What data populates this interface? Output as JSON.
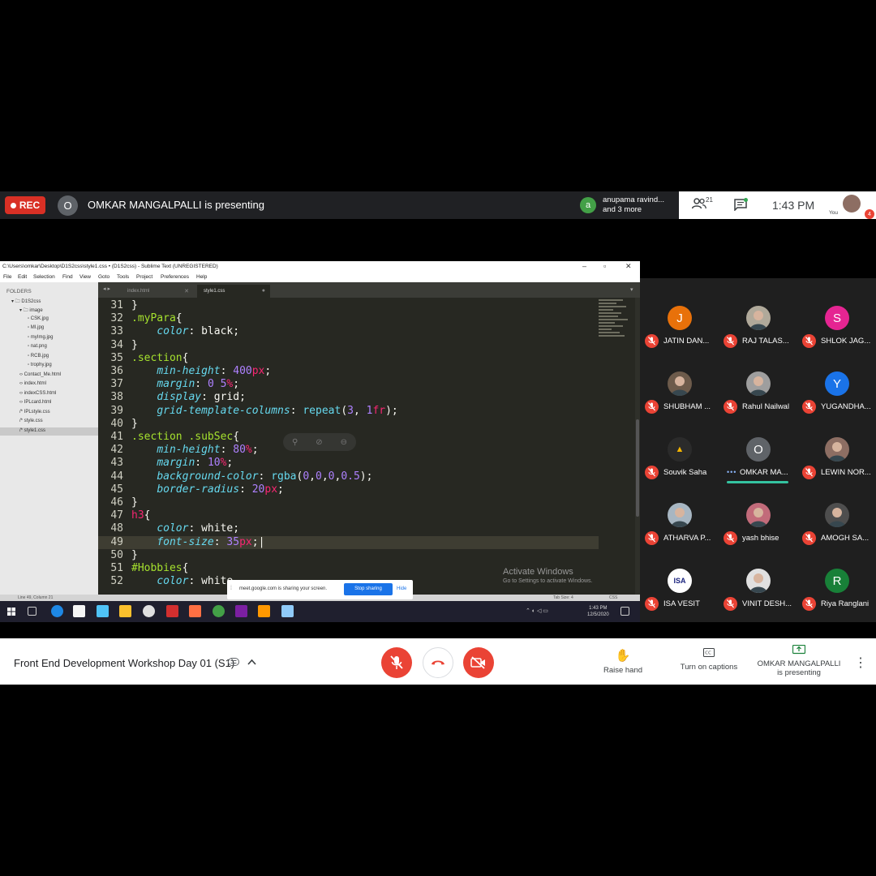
{
  "topbar": {
    "rec_label": "REC",
    "presenter_initial": "O",
    "presenter_text": "OMKAR MANGALPALLI is presenting",
    "notification_initial": "a",
    "notification_line1": "anupama ravind...",
    "notification_line2": "and 3 more",
    "participant_count": "21",
    "time": "1:43 PM",
    "you_label": "You",
    "badge_count": "4"
  },
  "screen": {
    "window_title": "C:\\Users\\omkar\\Desktop\\D1S2css\\style1.css • (D1S2css) - Sublime Text (UNREGISTERED)",
    "menu": [
      "File",
      "Edit",
      "Selection",
      "Find",
      "View",
      "Goto",
      "Tools",
      "Project",
      "Preferences",
      "Help"
    ],
    "sidebar": {
      "header": "FOLDERS",
      "root": "D1S2css",
      "image_folder": "image",
      "images": [
        "CSK.jpg",
        "MI.jpg",
        "myImg.jpg",
        "nat.png",
        "RCB.jpg",
        "trophy.jpg"
      ],
      "files": [
        "Contact_Me.html",
        "index.html",
        "indexCSS.html",
        "IPLcard.html",
        "IPLstyle.css",
        "style.css",
        "style1.css"
      ]
    },
    "tabs": [
      "index.html",
      "style1.css"
    ],
    "status_left": "Line 49, Column 21",
    "status_tab": "Tab Size: 4",
    "status_syntax": "CSS",
    "activate_title": "Activate Windows",
    "activate_sub": "Go to Settings to activate Windows.",
    "share_text": "meet.google.com is sharing your screen.",
    "stop_sharing": "Stop sharing",
    "hide": "Hide",
    "tray_time": "1:43 PM",
    "tray_date": "12/5/2020"
  },
  "code_lines": [
    {
      "n": "31",
      "parts": [
        [
          "p",
          "}"
        ]
      ]
    },
    {
      "n": "32",
      "parts": [
        [
          "s",
          ".myPara"
        ],
        [
          "p",
          "{"
        ]
      ]
    },
    {
      "n": "33",
      "parts": [
        [
          "p",
          "    "
        ],
        [
          "k",
          "color"
        ],
        [
          "p",
          ": black;"
        ]
      ]
    },
    {
      "n": "34",
      "parts": [
        [
          "p",
          "}"
        ]
      ]
    },
    {
      "n": "35",
      "parts": [
        [
          "s",
          ".section"
        ],
        [
          "p",
          "{"
        ]
      ]
    },
    {
      "n": "36",
      "parts": [
        [
          "p",
          "    "
        ],
        [
          "k",
          "min-height"
        ],
        [
          "p",
          ": "
        ],
        [
          "n",
          "400"
        ],
        [
          "u",
          "px"
        ],
        [
          "p",
          ";"
        ]
      ]
    },
    {
      "n": "37",
      "parts": [
        [
          "p",
          "    "
        ],
        [
          "k",
          "margin"
        ],
        [
          "p",
          ": "
        ],
        [
          "n",
          "0"
        ],
        [
          "p",
          " "
        ],
        [
          "n",
          "5"
        ],
        [
          "u",
          "%"
        ],
        [
          "p",
          ";"
        ]
      ]
    },
    {
      "n": "38",
      "parts": [
        [
          "p",
          "    "
        ],
        [
          "k",
          "display"
        ],
        [
          "p",
          ": grid;"
        ]
      ]
    },
    {
      "n": "39",
      "parts": [
        [
          "p",
          "    "
        ],
        [
          "k",
          "grid-template-columns"
        ],
        [
          "p",
          ": "
        ],
        [
          "f",
          "repeat"
        ],
        [
          "p",
          "("
        ],
        [
          "n",
          "3"
        ],
        [
          "p",
          ", "
        ],
        [
          "n",
          "1"
        ],
        [
          "u",
          "fr"
        ],
        [
          "p",
          ");"
        ]
      ]
    },
    {
      "n": "40",
      "parts": [
        [
          "p",
          "}"
        ]
      ]
    },
    {
      "n": "41",
      "parts": [
        [
          "s",
          ".section .subSec"
        ],
        [
          "p",
          "{"
        ]
      ]
    },
    {
      "n": "42",
      "parts": [
        [
          "p",
          "    "
        ],
        [
          "k",
          "min-height"
        ],
        [
          "p",
          ": "
        ],
        [
          "n",
          "80"
        ],
        [
          "u",
          "%"
        ],
        [
          "p",
          ";"
        ]
      ]
    },
    {
      "n": "43",
      "parts": [
        [
          "p",
          "    "
        ],
        [
          "k",
          "margin"
        ],
        [
          "p",
          ": "
        ],
        [
          "n",
          "10"
        ],
        [
          "u",
          "%"
        ],
        [
          "p",
          ";"
        ]
      ]
    },
    {
      "n": "44",
      "parts": [
        [
          "p",
          "    "
        ],
        [
          "k",
          "background-color"
        ],
        [
          "p",
          ": "
        ],
        [
          "f",
          "rgba"
        ],
        [
          "p",
          "("
        ],
        [
          "n",
          "0"
        ],
        [
          "p",
          ","
        ],
        [
          "n",
          "0"
        ],
        [
          "p",
          ","
        ],
        [
          "n",
          "0"
        ],
        [
          "p",
          ","
        ],
        [
          "n",
          "0.5"
        ],
        [
          "p",
          ");"
        ]
      ]
    },
    {
      "n": "45",
      "parts": [
        [
          "p",
          "    "
        ],
        [
          "k",
          "border-radius"
        ],
        [
          "p",
          ": "
        ],
        [
          "n",
          "20"
        ],
        [
          "u",
          "px"
        ],
        [
          "p",
          ";"
        ]
      ]
    },
    {
      "n": "46",
      "parts": [
        [
          "p",
          "}"
        ]
      ]
    },
    {
      "n": "47",
      "parts": [
        [
          "t",
          "h3"
        ],
        [
          "p",
          "{"
        ]
      ]
    },
    {
      "n": "48",
      "parts": [
        [
          "p",
          "    "
        ],
        [
          "k",
          "color"
        ],
        [
          "p",
          ": white;"
        ]
      ]
    },
    {
      "n": "49",
      "parts": [
        [
          "p",
          "    "
        ],
        [
          "k",
          "font-size"
        ],
        [
          "p",
          ": "
        ],
        [
          "n",
          "35"
        ],
        [
          "u",
          "px"
        ],
        [
          "p",
          ";"
        ]
      ]
    },
    {
      "n": "50",
      "parts": [
        [
          "p",
          "}"
        ]
      ]
    },
    {
      "n": "51",
      "parts": [
        [
          "s",
          "#Hobbies"
        ],
        [
          "p",
          "{"
        ]
      ]
    },
    {
      "n": "52",
      "parts": [
        [
          "p",
          "    "
        ],
        [
          "k",
          "color"
        ],
        [
          "p",
          ": white"
        ]
      ]
    }
  ],
  "participants": [
    {
      "name": "JATIN DAN...",
      "initial": "J",
      "color": "#e8710a",
      "photo": false
    },
    {
      "name": "RAJ TALAS...",
      "initial": "",
      "color": "#b0a99a",
      "photo": true
    },
    {
      "name": "SHLOK JAG...",
      "initial": "S",
      "color": "#e52592",
      "photo": false
    },
    {
      "name": "SHUBHAM ...",
      "initial": "",
      "color": "#6d5b4b",
      "photo": true
    },
    {
      "name": "Rahul Nailwal",
      "initial": "",
      "color": "#9e9e9e",
      "photo": true
    },
    {
      "name": "YUGANDHA...",
      "initial": "Y",
      "color": "#1a73e8",
      "photo": false
    },
    {
      "name": "Souvik Saha",
      "initial": "▲",
      "color": "#2b2b2b",
      "photo": false
    },
    {
      "name": "OMKAR MA...",
      "initial": "O",
      "color": "#5f6368",
      "photo": false,
      "presenting": true
    },
    {
      "name": "LEWIN NOR...",
      "initial": "",
      "color": "#8d6e63",
      "photo": true
    },
    {
      "name": "ATHARVA P...",
      "initial": "",
      "color": "#a7b6c2",
      "photo": true
    },
    {
      "name": "yash bhise",
      "initial": "",
      "color": "#c26b7a",
      "photo": true
    },
    {
      "name": "AMOGH SA...",
      "initial": "",
      "color": "#4e4e4e",
      "photo": true
    },
    {
      "name": "ISA VESIT",
      "initial": "ISA",
      "color": "#ffffff",
      "photo": false
    },
    {
      "name": "VINIT DESH...",
      "initial": "",
      "color": "#e0e0e0",
      "photo": true
    },
    {
      "name": "Riya Ranglani",
      "initial": "R",
      "color": "#188038",
      "photo": false
    }
  ],
  "bottombar": {
    "meeting_title": "Front End Development Workshop Day 01 (S1)",
    "raise_hand": "Raise hand",
    "captions": "Turn on captions",
    "presenting_name": "OMKAR MANGALPALLI",
    "presenting_sub": "is presenting"
  },
  "colors": {
    "mic_off_red": "#ea4335",
    "meet_dark": "#202124",
    "editor_bg": "#272822",
    "presenting_underline": "#34c3a0"
  }
}
